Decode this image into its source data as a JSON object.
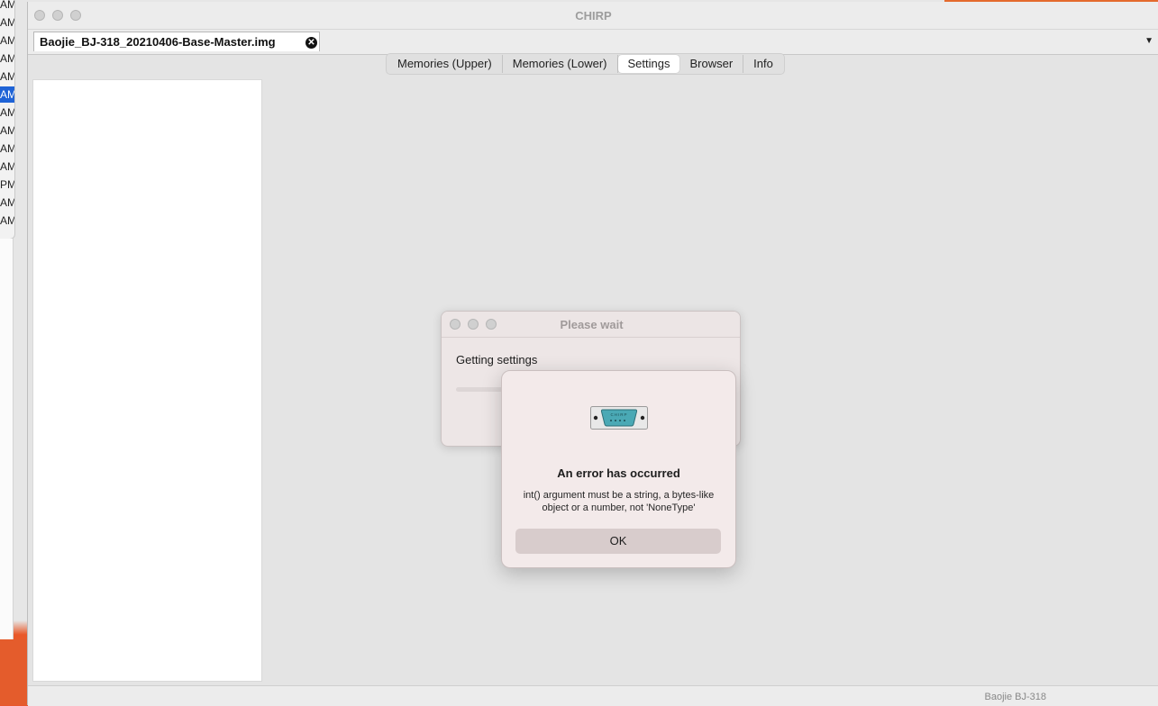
{
  "background": {
    "time_rows": [
      {
        "label": "AM",
        "selected": false
      },
      {
        "label": "AM",
        "selected": false
      },
      {
        "label": "AM",
        "selected": false
      },
      {
        "label": "AM",
        "selected": false
      },
      {
        "label": "AM",
        "selected": false
      },
      {
        "label": "AM",
        "selected": true
      },
      {
        "label": "AM",
        "selected": false
      },
      {
        "label": "AM",
        "selected": false
      },
      {
        "label": "AM",
        "selected": false
      },
      {
        "label": "AM",
        "selected": false
      },
      {
        "label": "PM",
        "selected": false
      },
      {
        "label": "AM",
        "selected": false
      },
      {
        "label": "AM",
        "selected": false
      }
    ]
  },
  "window": {
    "title": "CHIRP",
    "file_tab": "Baojie_BJ-318_20210406-Base-Master.img",
    "tabs": [
      {
        "label": "Memories (Upper)",
        "active": false
      },
      {
        "label": "Memories (Lower)",
        "active": false
      },
      {
        "label": "Settings",
        "active": true
      },
      {
        "label": "Browser",
        "active": false
      },
      {
        "label": "Info",
        "active": false
      }
    ],
    "status": "Baojie BJ-318"
  },
  "wait_dialog": {
    "title": "Please wait",
    "label": "Getting settings"
  },
  "error_dialog": {
    "icon": "serial-port-icon",
    "icon_text": "CHIRP",
    "title": "An error has occurred",
    "message": "int() argument must be a string, a bytes-like object or a number, not 'NoneType'",
    "ok_label": "OK"
  },
  "colors": {
    "accent_selected": "#1f63d6",
    "desktop_orange": "#e9572b",
    "icon_teal": "#4aa9b5"
  }
}
